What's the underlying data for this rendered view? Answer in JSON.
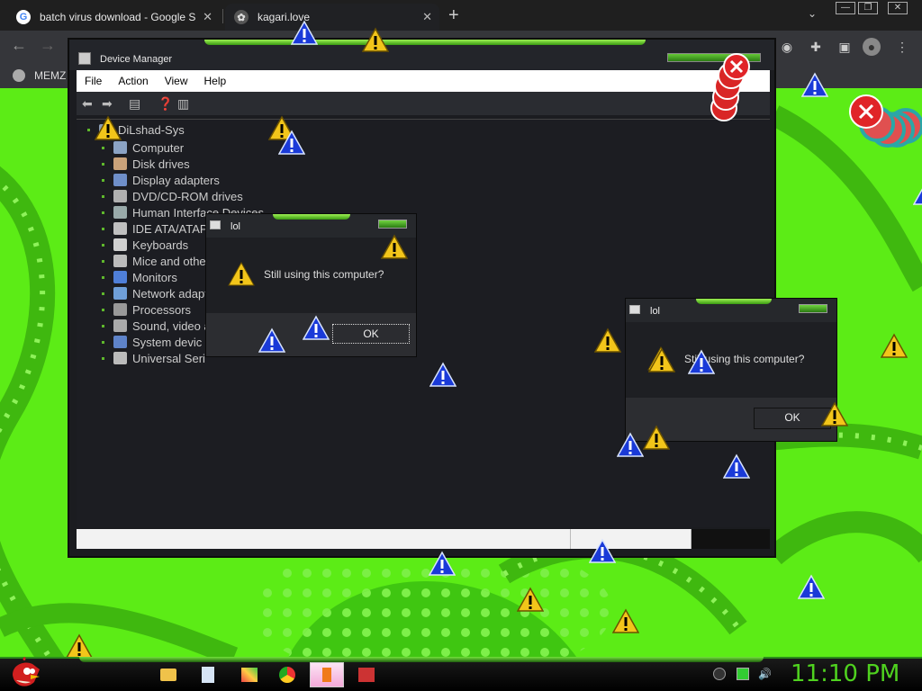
{
  "browser": {
    "tabs": [
      {
        "title": "batch virus download - Google S",
        "favicon": "google-g-icon",
        "active": false
      },
      {
        "title": "kagari.love",
        "favicon": "kagari-icon",
        "active": true
      }
    ],
    "new_tab": "+",
    "tab_menu": "⌄",
    "bookmark": "MEMZ"
  },
  "device_manager": {
    "title": "Device Manager",
    "menu": [
      "File",
      "Action",
      "View",
      "Help"
    ],
    "root": "DiLshad-Sys",
    "items": [
      "Computer",
      "Disk drives",
      "Display adapters",
      "DVD/CD-ROM drives",
      "Human Interface Devices",
      "IDE ATA/ATAPI",
      "Keyboards",
      "Mice and othe",
      "Monitors",
      "Network adapt",
      "Processors",
      "Sound, video a",
      "System devic",
      "Universal Seri"
    ]
  },
  "dialogs": [
    {
      "title": "lol",
      "message": "Still using this computer?",
      "ok": "OK"
    },
    {
      "title": "lol",
      "message": "Still using this computer?",
      "ok": "OK"
    }
  ],
  "taskbar": {
    "clock": "11:10 PM",
    "tasks": [
      "folder-icon",
      "notepad-icon",
      "paint-icon",
      "chrome-icon",
      "active-app-icon",
      "control-panel-icon"
    ]
  },
  "colors": {
    "wallpaper_green": "#5cec16",
    "accent_green": "#4fd21f",
    "warning_yellow": "#f2c51a",
    "warning_blue": "#1a3ad8",
    "error_red": "#e02428"
  }
}
